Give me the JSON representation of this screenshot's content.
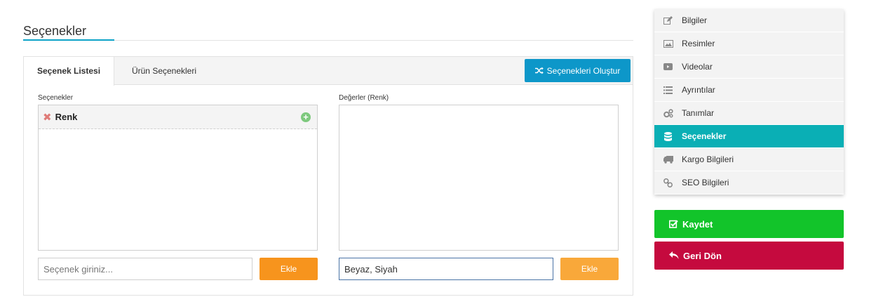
{
  "heading": "Seçenekler",
  "tabs": [
    {
      "label": "Seçenek Listesi",
      "active": true
    },
    {
      "label": "Ürün Seçenekleri",
      "active": false
    }
  ],
  "generate_button": "Seçenekleri Oluştur",
  "options_panel": {
    "label": "Seçenekler",
    "items": [
      {
        "name": "Renk"
      }
    ],
    "input_placeholder": "Seçenek giriniz...",
    "add_label": "Ekle"
  },
  "values_panel": {
    "label": "Değerler (Renk)",
    "input_value": "Beyaz, Siyah",
    "add_label": "Ekle"
  },
  "sidebar": {
    "items": [
      {
        "label": "Bilgiler",
        "icon": "edit-icon"
      },
      {
        "label": "Resimler",
        "icon": "image-icon"
      },
      {
        "label": "Videolar",
        "icon": "video-icon"
      },
      {
        "label": "Ayrıntılar",
        "icon": "list-icon"
      },
      {
        "label": "Tanımlar",
        "icon": "gears-icon"
      },
      {
        "label": "Seçenekler",
        "icon": "database-icon",
        "active": true
      },
      {
        "label": "Kargo Bilgileri",
        "icon": "truck-icon"
      },
      {
        "label": "SEO Bilgileri",
        "icon": "link-icon"
      }
    ]
  },
  "save_button": "Kaydet",
  "back_button": "Geri Dön",
  "colors": {
    "accent": "#0ea3c8",
    "generate": "#0d97c9",
    "add": "#f7941d",
    "active_menu": "#0aafb5",
    "save": "#12c42a",
    "back": "#c50a3e"
  }
}
